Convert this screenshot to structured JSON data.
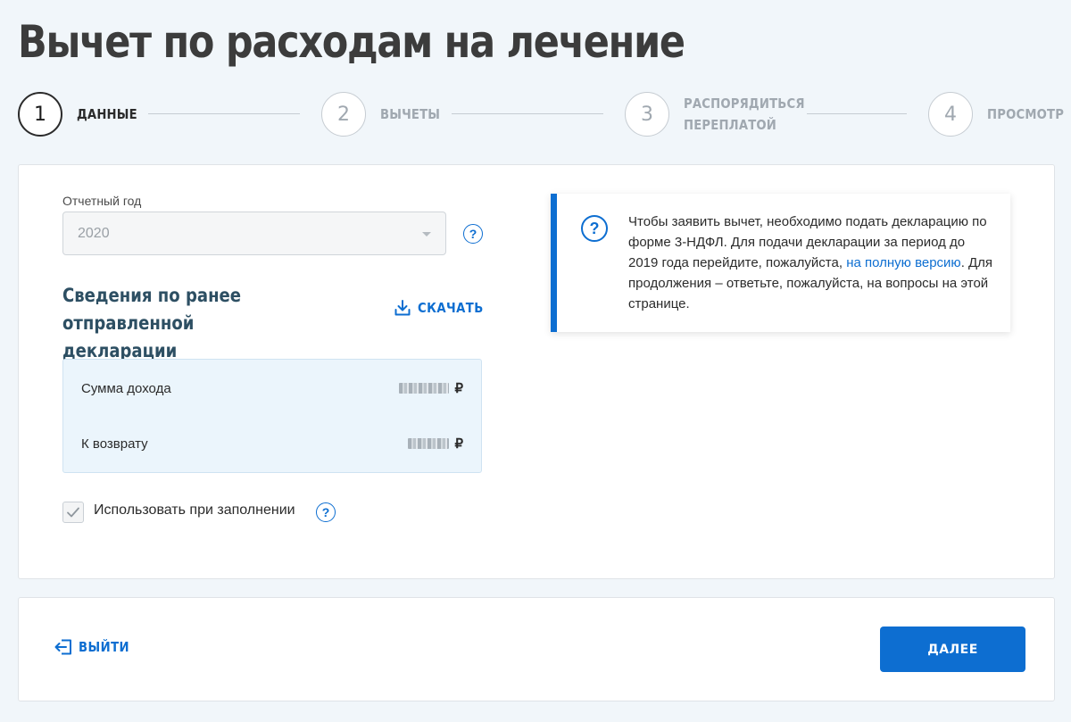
{
  "page": {
    "title": "Вычет по расходам на лечение"
  },
  "stepper": {
    "steps": [
      {
        "number": "1",
        "label": "ДАННЫЕ"
      },
      {
        "number": "2",
        "label": "ВЫЧЕТЫ"
      },
      {
        "number": "3",
        "label_line1": "РАСПОРЯДИТЬСЯ",
        "label_line2": "ПЕРЕПЛАТОЙ"
      },
      {
        "number": "4",
        "label": "ПРОСМОТР"
      }
    ],
    "active_step": 1
  },
  "form": {
    "year_label": "Отчетный год",
    "year_value": "2020",
    "section_title": "Сведения по ранее отправленной декларации",
    "download_label": "СКАЧАТЬ",
    "summary": {
      "income_label": "Сумма дохода",
      "income_currency": "₽",
      "refund_label": "К возврату",
      "refund_currency": "₽"
    },
    "use_checkbox_label": "Использовать при заполнении",
    "use_checkbox_checked": true
  },
  "info": {
    "text_before_link": "Чтобы заявить вычет, необходимо подать декларацию по форме 3-НДФЛ. Для подачи декларации за период до 2019 года перейдите, пожалуйста, ",
    "link_text": "на полную версию",
    "text_after_link": ". Для продолжения – ответьте, пожалуйста, на вопросы на этой странице."
  },
  "footer": {
    "exit_label": "ВЫЙТИ",
    "next_label": "ДАЛЕЕ"
  },
  "colors": {
    "accent": "#0d6ed1",
    "background": "#f1f6fa",
    "summary_bg": "#ebf5fc"
  },
  "icons": [
    "help-icon",
    "download-icon",
    "info-icon",
    "checkmark-icon",
    "exit-icon",
    "chevron-down-icon"
  ]
}
